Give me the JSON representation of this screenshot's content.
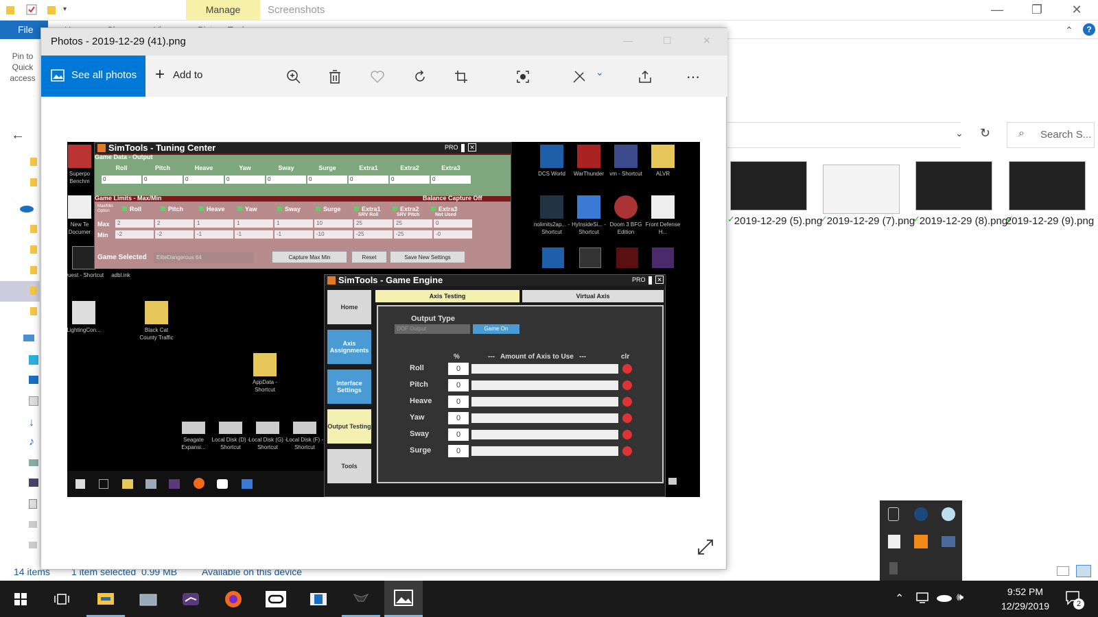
{
  "explorer": {
    "manage_tab": "Manage",
    "folder_title": "Screenshots",
    "file_tab": "File",
    "ribbon_tabs": [
      "Home",
      "Share",
      "View",
      "Picture Tools"
    ],
    "pin_label": "Pin to Quick access",
    "search_placeholder": "Search S...",
    "thumbnails": [
      {
        "label": "2019-12-29 (5).png"
      },
      {
        "label": "2019-12-29 (7).png"
      },
      {
        "label": "2019-12-29 (8).png"
      },
      {
        "label": "2019-12-29 (9).png"
      }
    ],
    "status": {
      "count": "14 items",
      "selected": "1 item selected  0.99 MB",
      "availability": "Available on this device"
    }
  },
  "photos": {
    "title": "Photos - 2019-12-29 (41).png",
    "see_all": "See all photos",
    "add_to": "Add to"
  },
  "screenshot": {
    "desktop_icons": [
      {
        "label": "Superpo Benchm"
      },
      {
        "label": "New Te Documer"
      },
      {
        "label": "Quest - Shortcut"
      },
      {
        "label": "adbl.ink"
      },
      {
        "label": "LightingCon..."
      },
      {
        "label": "Black Cat County Traffic"
      },
      {
        "label": "AppData - Shortcut"
      },
      {
        "label": "Seagate Expansi..."
      },
      {
        "label": "Local Disk (D) - Shortcut"
      },
      {
        "label": "Local Disk (G) - Shortcut"
      },
      {
        "label": "Local Disk (F) - Shortcut"
      },
      {
        "label": "DCS World"
      },
      {
        "label": "WarThunder"
      },
      {
        "label": "vm - Shortcut"
      },
      {
        "label": "ALVR"
      },
      {
        "label": "nolimits2ap... - Shortcut"
      },
      {
        "label": "HyInsideSi... - Shortcut"
      },
      {
        "label": "Doom 3 BFG Edition"
      },
      {
        "label": "Front Defense H..."
      }
    ],
    "tuning_center": {
      "title": "SimTools - Tuning Center",
      "pro": "PRO",
      "section_output": "Game Data - Output",
      "columns": [
        "Roll",
        "Pitch",
        "Heave",
        "Yaw",
        "Sway",
        "Surge",
        "Extra1",
        "Extra2",
        "Extra3"
      ],
      "output_values": [
        "0",
        "0",
        "0",
        "0",
        "0",
        "0",
        "0",
        "0",
        "0"
      ],
      "section_limits": "Game Limits - Max/Min",
      "balance": "Balance Capture Off",
      "option_label": "Max/Min Option",
      "srv_labels": [
        "SRV Roll",
        "SRV Pitch",
        "Not Used"
      ],
      "max_label": "Max",
      "min_label": "Min",
      "max_values": [
        "2",
        "2",
        "1",
        "1",
        "1",
        "10",
        "25",
        "25",
        "0"
      ],
      "min_values": [
        "-2",
        "-2",
        "-1",
        "-1",
        "-1",
        "-10",
        "-25",
        "-25",
        "-0"
      ],
      "game_selected_label": "Game Selected",
      "game_selected_value": "EliteDangerous 64",
      "capture_btn": "Capture Max Min",
      "reset_btn": "Reset",
      "save_btn": "Save New Settings"
    },
    "game_engine": {
      "title": "SimTools - Game Engine",
      "pro": "PRO",
      "nav": [
        "Home",
        "Axis Assignments",
        "Interface Settings",
        "Output Testing",
        "Tools"
      ],
      "tab_axis": "Axis Testing",
      "tab_virtual": "Virtual Axis",
      "output_type": "Output Type",
      "output_select": "DOF Output",
      "game_on": "Game On",
      "pct": "%",
      "amount": "---   Amount of Axis to Use   ---",
      "clr": "clr",
      "axes": [
        {
          "name": "Roll",
          "value": "0"
        },
        {
          "name": "Pitch",
          "value": "0"
        },
        {
          "name": "Heave",
          "value": "0"
        },
        {
          "name": "Yaw",
          "value": "0"
        },
        {
          "name": "Sway",
          "value": "0"
        },
        {
          "name": "Surge",
          "value": "0"
        }
      ]
    }
  },
  "taskbar": {
    "time": "9:52 PM",
    "date": "12/29/2019",
    "notification_count": "2"
  },
  "colors": {
    "accent": "#0078d7",
    "manage": "#f6f0a8",
    "taskbar": "#1a1a1a"
  }
}
